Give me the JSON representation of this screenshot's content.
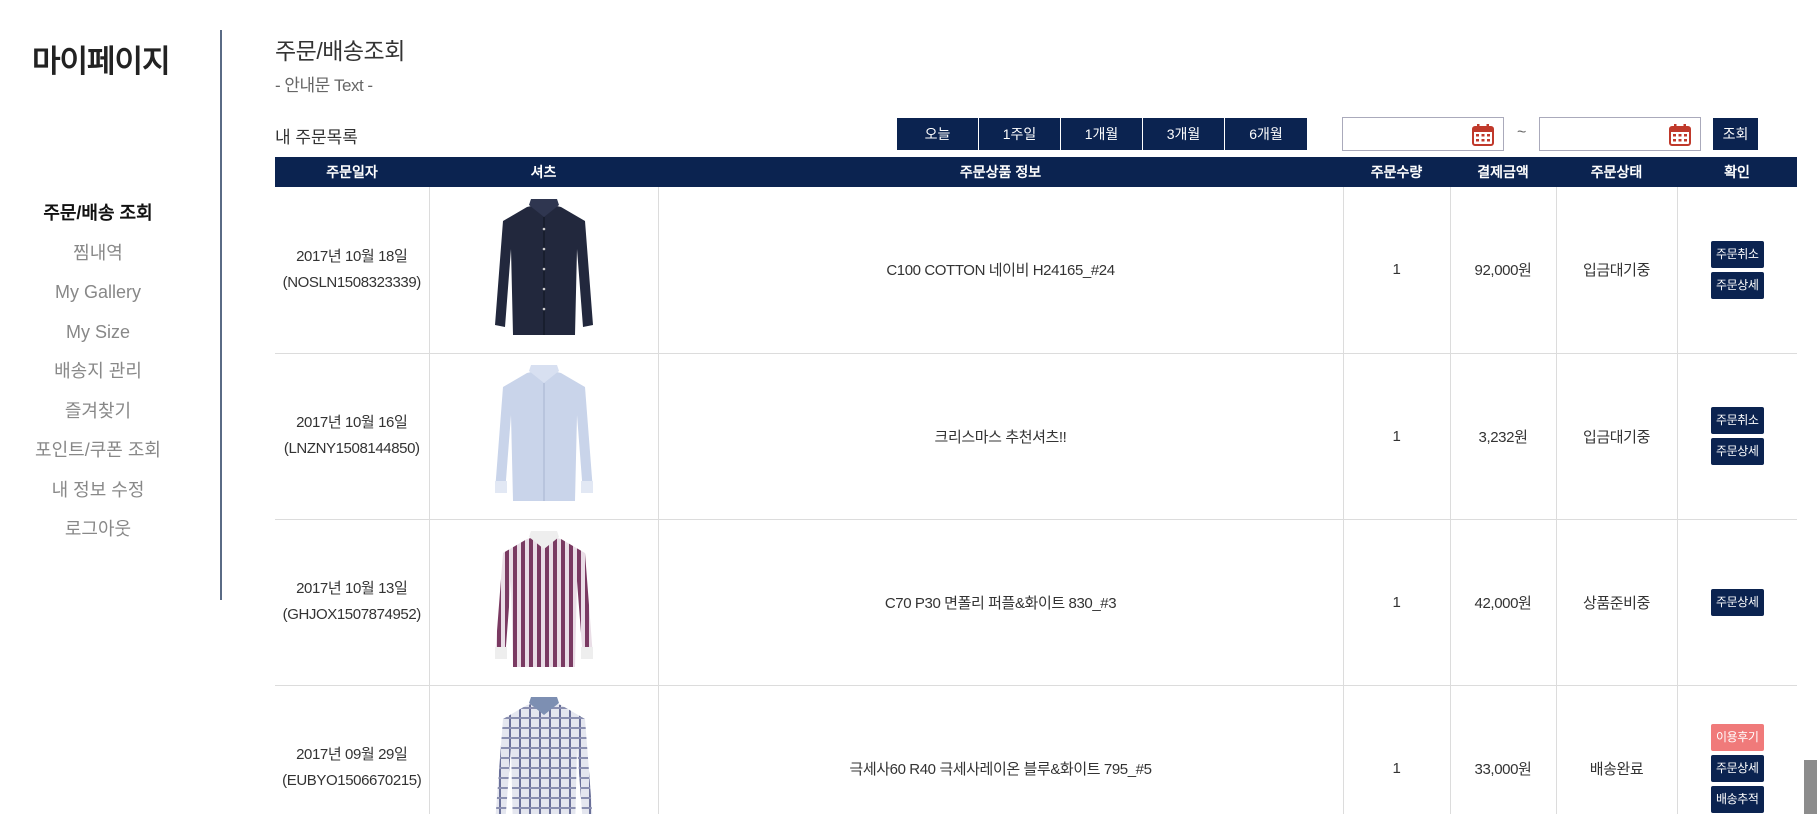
{
  "sidebar": {
    "title": "마이페이지",
    "items": [
      {
        "label": "주문/배송 조회",
        "active": true
      },
      {
        "label": "찜내역"
      },
      {
        "label": "My Gallery"
      },
      {
        "label": "My Size"
      },
      {
        "label": "배송지 관리"
      },
      {
        "label": "즐겨찾기"
      },
      {
        "label": "포인트/쿠폰 조회"
      },
      {
        "label": "내 정보 수정"
      },
      {
        "label": "로그아웃"
      }
    ]
  },
  "main": {
    "title": "주문/배송조회",
    "description": "- 안내문 Text -",
    "list_title": "내 주문목록",
    "period_buttons": [
      "오늘",
      "1주일",
      "1개월",
      "3개월",
      "6개월"
    ],
    "date_from": "",
    "date_to": "",
    "tilde": "~",
    "search_label": "조회"
  },
  "table": {
    "headers": [
      "주문일자",
      "셔츠",
      "주문상품 정보",
      "주문수량",
      "결제금액",
      "주문상태",
      "확인"
    ],
    "rows": [
      {
        "date": "2017년 10월 18일",
        "order_no": "(NOSLN1508323339)",
        "product": "C100 COTTON 네이비 H24165_#24",
        "qty": "1",
        "amount": "92,000원",
        "status": "입금대기중",
        "shirt": "navy-solid",
        "actions": [
          "주문취소",
          "주문상세"
        ]
      },
      {
        "date": "2017년 10월 16일",
        "order_no": "(LNZNY1508144850)",
        "product": "크리스마스 추천셔츠!!",
        "qty": "1",
        "amount": "3,232원",
        "status": "입금대기중",
        "shirt": "light-blue",
        "actions": [
          "주문취소",
          "주문상세"
        ]
      },
      {
        "date": "2017년 10월 13일",
        "order_no": "(GHJOX1507874952)",
        "product": "C70 P30 면폴리 퍼플&화이트 830_#3",
        "qty": "1",
        "amount": "42,000원",
        "status": "상품준비중",
        "shirt": "purple-stripe",
        "actions": [
          "주문상세"
        ]
      },
      {
        "date": "2017년 09월 29일",
        "order_no": "(EUBYO1506670215)",
        "product": "극세사60 R40 극세사레이온 블루&화이트 795_#5",
        "qty": "1",
        "amount": "33,000원",
        "status": "배송완료",
        "shirt": "blue-check",
        "actions": [
          "이용후기",
          "주문상세",
          "배송추적"
        ]
      }
    ]
  },
  "colors": {
    "navy": "#0b2350",
    "review": "#f07a7a",
    "calendar": "#c0392b"
  }
}
